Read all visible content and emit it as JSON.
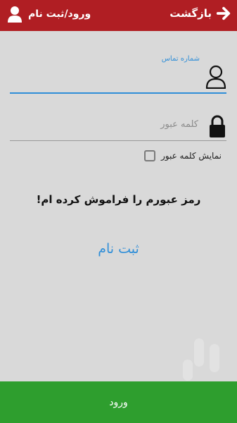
{
  "header": {
    "back_label": "بازگشت",
    "title": "ورود/ثبت نام",
    "bg_color": "#b01e23"
  },
  "form": {
    "phone": {
      "label": "شماره تماس",
      "value": "",
      "icon": "user-outline-icon",
      "active": true
    },
    "password": {
      "placeholder": "کلمه عبور",
      "value": "",
      "icon": "lock-icon"
    },
    "show_password": {
      "label": "نمایش کلمه عبور",
      "checked": false
    }
  },
  "links": {
    "forgot": "رمز عبورم را فراموش کرده ام!",
    "register": "ثبت نام"
  },
  "footer": {
    "login_label": "ورود",
    "bg_color": "#2e9e2e"
  },
  "colors": {
    "accent": "#2f8ed8",
    "background": "#d9d9d9"
  }
}
